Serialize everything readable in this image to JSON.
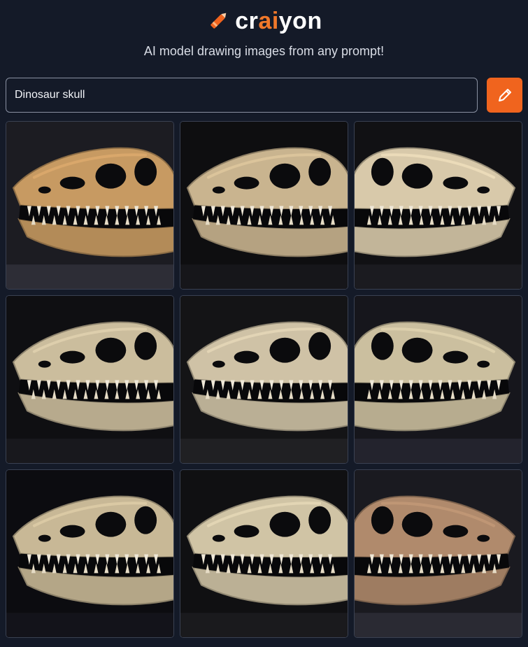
{
  "brand": {
    "prefix": "cr",
    "highlight": "ai",
    "suffix": "yon"
  },
  "tagline": "AI model drawing images from any prompt!",
  "search": {
    "value": "Dinosaur skull"
  },
  "draw_button": {
    "icon": "pencil-icon"
  },
  "colors": {
    "background": "#141a28",
    "accent": "#f0641e",
    "brand_highlight": "#f0782a"
  },
  "gallery": {
    "count": 9,
    "items": [
      {
        "bg": "#1c1c22",
        "bone": "#c79a62"
      },
      {
        "bg": "#0e0e10",
        "bone": "#c9b48f"
      },
      {
        "bg": "#111114",
        "bone": "#d8c9aa"
      },
      {
        "bg": "#0f0f12",
        "bone": "#cbbd9d"
      },
      {
        "bg": "#141416",
        "bone": "#cfc2a6"
      },
      {
        "bg": "#16161c",
        "bone": "#cbbf9f"
      },
      {
        "bg": "#0c0c10",
        "bone": "#c8b896"
      },
      {
        "bg": "#101012",
        "bone": "#d0c4a5"
      },
      {
        "bg": "#1a1a20",
        "bone": "#b08a6c"
      }
    ]
  }
}
